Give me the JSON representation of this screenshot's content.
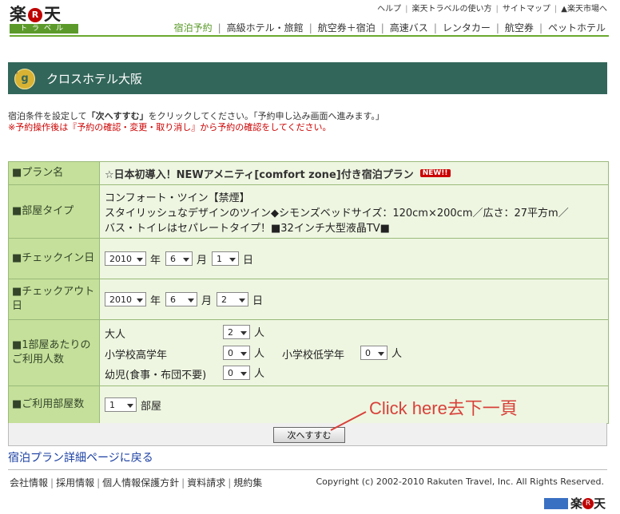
{
  "logo": {
    "text_1": "楽",
    "r": "R",
    "text_2": "天",
    "sub": "トラベル"
  },
  "header": {
    "top_links": [
      "ヘルプ",
      "楽天トラベルの使い方",
      "サイトマップ",
      "▲楽天市場へ"
    ],
    "nav": [
      "宿泊予約",
      "高級ホテル・旅館",
      "航空券＋宿泊",
      "高速バス",
      "レンタカー",
      "航空券",
      "ペットホテル"
    ],
    "active_nav_index": 0
  },
  "hotel": {
    "emblem": "g",
    "name": "クロスホテル大阪"
  },
  "notes": {
    "line1_pre": "宿泊条件を設定して",
    "line1_bold": "「次へすすむ」",
    "line1_post": "をクリックしてください。「予約申し込み画面へ進みます。」",
    "line2": "※予約操作後は『予約の確認・変更・取り消し』から予約の確認をしてください。"
  },
  "form": {
    "plan": {
      "label": "■プラン名",
      "value": "☆日本初導入！NEWアメニティ[comfort zone]付き宿泊プラン",
      "badge": "NEW!!"
    },
    "room": {
      "label": "■部屋タイプ",
      "lines": [
        "コンフォート・ツイン【禁煙】",
        "スタイリッシュなデザインのツイン◆シモンズベッドサイズ：120cm×200cm／広さ：27平方m／",
        "バス・トイレはセパレートタイプ！■32インチ大型液晶TV■"
      ]
    },
    "checkin": {
      "label": "■チェックイン日",
      "year": "2010",
      "month": "6",
      "day": "1"
    },
    "checkout": {
      "label": "■チェックアウト日",
      "year": "2010",
      "month": "6",
      "day": "2"
    },
    "units": {
      "year": "年",
      "month": "月",
      "day": "日",
      "person": "人",
      "room": "部屋"
    },
    "guests": {
      "label": "■1部屋あたりのご利用人数",
      "adult_label": "大人",
      "adult": "2",
      "elem_high_label": "小学校高学年",
      "elem_high": "0",
      "elem_low_label": "小学校低学年",
      "elem_low": "0",
      "infant_label": "幼児(食事・布団不要)",
      "infant": "0"
    },
    "rooms": {
      "label": "■ご利用部屋数",
      "value": "1"
    }
  },
  "submit": {
    "label": "次へすすむ"
  },
  "annotation": {
    "text": "Click here去下一頁",
    "color": "#d8413a"
  },
  "back_link": "宿泊プラン詳細ページに戻る",
  "footer": {
    "links": [
      "会社情報",
      "採用情報",
      "個人情報保護方針",
      "資料請求",
      "規約集"
    ],
    "copyright": "Copyright (c) 2002-2010 Rakuten Travel, Inc. All Rights Reserved.",
    "logo_text_1": "楽",
    "logo_r": "R",
    "logo_text_2": "天"
  }
}
